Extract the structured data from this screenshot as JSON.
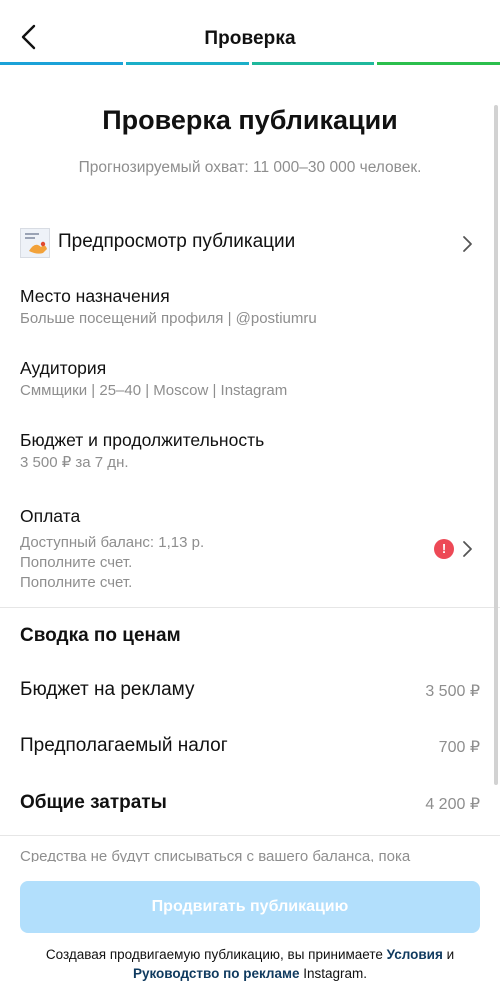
{
  "header": {
    "title": "Проверка",
    "progress_colors": [
      "#1ba2d8",
      "#1bafc8",
      "#1fb89c",
      "#2bbf4d"
    ]
  },
  "main": {
    "title": "Проверка публикации",
    "estimated_reach": "Прогнозируемый охват: 11 000–30 000 человек.",
    "preview_label": "Предпросмотр публикации",
    "destination": {
      "label": "Место назначения",
      "value": "Больше посещений профиля | @postiumru"
    },
    "audience": {
      "label": "Аудитория",
      "value": "Сммщики | 25–40 | Moscow | Instagram"
    },
    "budget": {
      "label": "Бюджет и продолжительность",
      "value": "3 500 ₽ за 7 дн."
    },
    "payment": {
      "label": "Оплата",
      "lines": [
        "Доступный баланс: 1,13 р.",
        "Пополните счет.",
        "Пополните счет."
      ],
      "alert_glyph": "!"
    }
  },
  "summary": {
    "title": "Сводка по ценам",
    "rows": [
      {
        "label": "Бюджет на рекламу",
        "value": "3 500 ₽"
      },
      {
        "label": "Предполагаемый налог",
        "value": "700 ₽"
      },
      {
        "label": "Общие затраты",
        "value": "4 200 ₽"
      }
    ],
    "note": "Средства не будут списываться с вашего баланса, пока"
  },
  "footer": {
    "button_label": "Продвигать публикацию",
    "terms_before": "Создавая продвигаемую публикацию, вы принимаете ",
    "terms_link": "Условия",
    "terms_mid": " и ",
    "guidelines_link": "Руководство по рекламе",
    "terms_after": " Instagram.",
    "accent_color": "#b2dffc"
  }
}
